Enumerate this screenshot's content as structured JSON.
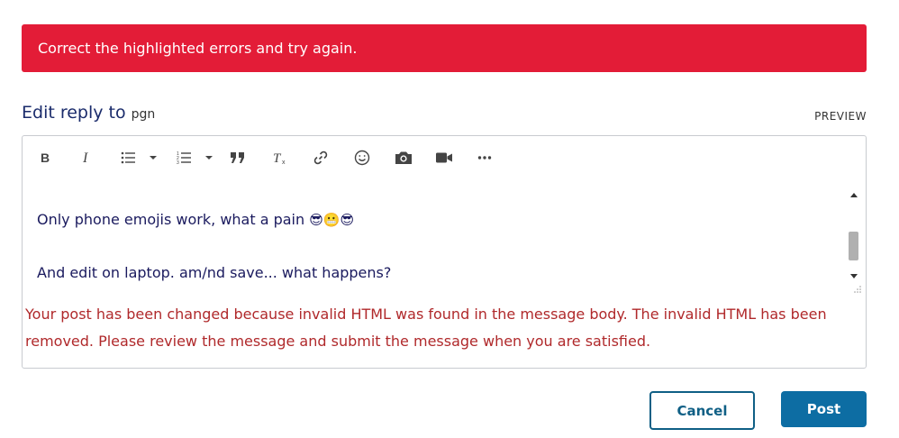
{
  "error_banner": {
    "message": "Correct the highlighted errors and try again.",
    "color": "#e31c37"
  },
  "header": {
    "title": "Edit reply to",
    "target": "pgn",
    "preview_label": "PREVIEW"
  },
  "toolbar": {
    "items": [
      {
        "name": "bold",
        "icon": "bold-icon"
      },
      {
        "name": "italic",
        "icon": "italic-icon"
      },
      {
        "name": "bullet-list",
        "icon": "bullet-list-icon"
      },
      {
        "name": "numbered-list",
        "icon": "numbered-list-icon"
      },
      {
        "name": "quote",
        "icon": "quote-icon"
      },
      {
        "name": "clear-format",
        "icon": "clear-format-icon"
      },
      {
        "name": "link",
        "icon": "link-icon"
      },
      {
        "name": "emoji",
        "icon": "smiley-icon"
      },
      {
        "name": "photo",
        "icon": "camera-icon"
      },
      {
        "name": "video",
        "icon": "video-icon"
      },
      {
        "name": "more",
        "icon": "more-icon"
      }
    ]
  },
  "editor": {
    "line1": "Only phone emojis work, what a pain",
    "line1_emojis": "😎😬😎",
    "line2": "And edit on laptop. am/nd save... what happens?"
  },
  "validation_message": "Your post has been changed because invalid HTML was found in the message body. The invalid HTML has been removed. Please review the message and submit the message when you are satisfied.",
  "buttons": {
    "cancel": "Cancel",
    "post": "Post",
    "accent": "#0d6da3"
  }
}
